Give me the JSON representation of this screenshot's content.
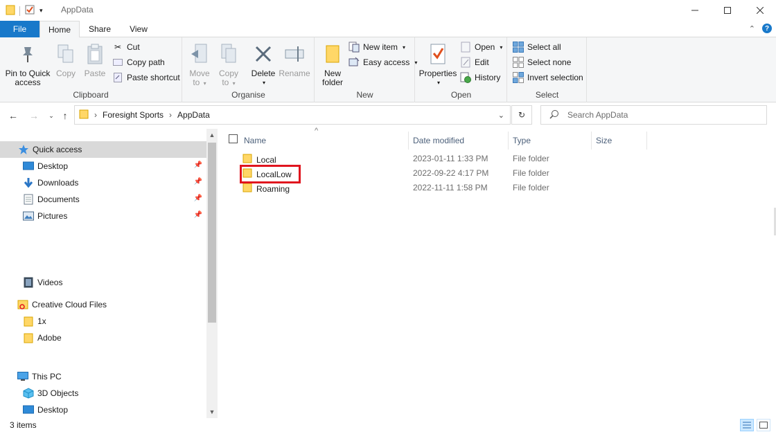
{
  "window": {
    "title": "AppData"
  },
  "ribbon_tabs": {
    "file": "File",
    "home": "Home",
    "share": "Share",
    "view": "View"
  },
  "ribbon": {
    "clipboard": {
      "label": "Clipboard",
      "pin_to_quick_access_line1": "Pin to Quick",
      "pin_to_quick_access_line2": "access",
      "copy": "Copy",
      "paste": "Paste",
      "cut": "Cut",
      "copy_path": "Copy path",
      "paste_shortcut": "Paste shortcut"
    },
    "organise": {
      "label": "Organise",
      "move_to_line1": "Move",
      "move_to_line2": "to",
      "copy_to_line1": "Copy",
      "copy_to_line2": "to",
      "delete": "Delete",
      "rename": "Rename"
    },
    "new": {
      "label": "New",
      "new_folder_line1": "New",
      "new_folder_line2": "folder",
      "new_item": "New item",
      "easy_access": "Easy access"
    },
    "open": {
      "label": "Open",
      "properties": "Properties",
      "open": "Open",
      "edit": "Edit",
      "history": "History"
    },
    "select": {
      "label": "Select",
      "select_all": "Select all",
      "select_none": "Select none",
      "invert_selection": "Invert selection"
    }
  },
  "address_bar": {
    "breadcrumb": [
      "Foresight Sports",
      "AppData"
    ],
    "search_placeholder": "Search AppData"
  },
  "nav_pane": {
    "items": [
      {
        "label": "Quick access",
        "icon": "star-icon",
        "pinned": false
      },
      {
        "label": "Desktop",
        "icon": "desktop-icon",
        "pinned": true
      },
      {
        "label": "Downloads",
        "icon": "download-icon",
        "pinned": true
      },
      {
        "label": "Documents",
        "icon": "document-icon",
        "pinned": true
      },
      {
        "label": "Pictures",
        "icon": "pictures-icon",
        "pinned": true
      },
      {
        "label": "Videos",
        "icon": "video-icon",
        "pinned": false
      },
      {
        "label": "Creative Cloud Files",
        "icon": "creative-cloud-icon",
        "pinned": false
      },
      {
        "label": "1x",
        "icon": "folder-icon",
        "pinned": false
      },
      {
        "label": "Adobe",
        "icon": "folder-icon",
        "pinned": false
      },
      {
        "label": "This PC",
        "icon": "pc-icon",
        "pinned": false
      },
      {
        "label": "3D Objects",
        "icon": "cube-icon",
        "pinned": false
      },
      {
        "label": "Desktop",
        "icon": "desktop-icon",
        "pinned": false
      }
    ]
  },
  "file_list": {
    "columns": {
      "name": "Name",
      "date_modified": "Date modified",
      "type": "Type",
      "size": "Size"
    },
    "rows": [
      {
        "name": "Local",
        "date": "2023-01-11 1:33 PM",
        "type": "File folder"
      },
      {
        "name": "LocalLow",
        "date": "2022-09-22 4:17 PM",
        "type": "File folder"
      },
      {
        "name": "Roaming",
        "date": "2022-11-11 1:58 PM",
        "type": "File folder"
      }
    ]
  },
  "status_bar": {
    "item_count": "3 items"
  },
  "colors": {
    "file_tab": "#1979ca",
    "folder": "#ffd767",
    "highlight": "#e0141e",
    "selected_nav": "#d9d9d9"
  }
}
